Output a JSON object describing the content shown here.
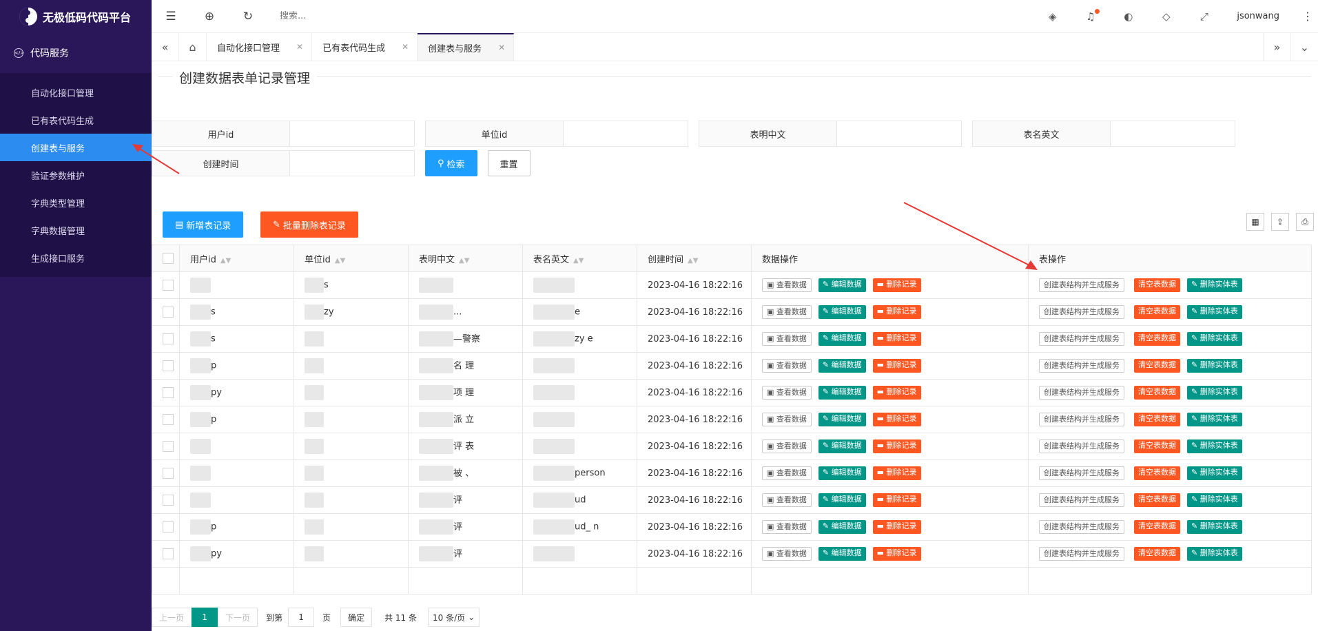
{
  "brand": {
    "title": "无极低码代码平台"
  },
  "sidebar": {
    "group_label": "代码服务",
    "items": [
      {
        "label": "自动化接口管理",
        "active": false
      },
      {
        "label": "已有表代码生成",
        "active": false
      },
      {
        "label": "创建表与服务",
        "active": true
      },
      {
        "label": "验证参数维护",
        "active": false
      },
      {
        "label": "字典类型管理",
        "active": false
      },
      {
        "label": "字典数据管理",
        "active": false
      },
      {
        "label": "生成接口服务",
        "active": false
      }
    ]
  },
  "header": {
    "search_placeholder": "搜索...",
    "username": "jsonwang",
    "notification_dot_color": "#ff5722",
    "icons": [
      "menu-fold-icon",
      "globe-icon",
      "refresh-icon",
      "layers-icon",
      "bell-icon",
      "palette-icon",
      "tag-icon",
      "fullscreen-icon",
      "more-vertical-icon"
    ]
  },
  "tabs": [
    {
      "label": "自动化接口管理",
      "active": false
    },
    {
      "label": "已有表代码生成",
      "active": false
    },
    {
      "label": "创建表与服务",
      "active": true
    }
  ],
  "page": {
    "title": "创建数据表单记录管理",
    "filters": {
      "user_id_label": "用户id",
      "unit_id_label": "单位id",
      "table_cn_label": "表明中文",
      "table_en_label": "表名英文",
      "created_label": "创建时间",
      "search_btn": "检索",
      "reset_btn": "重置"
    },
    "toolbar": {
      "add_btn": "新增表记录",
      "batch_delete_btn": "批量删除表记录",
      "add_color": "#1e9fff",
      "batch_delete_color": "#ff5722"
    }
  },
  "table": {
    "columns": [
      "用户id",
      "单位id",
      "表明中文",
      "表名英文",
      "创建时间",
      "数据操作",
      "表操作"
    ],
    "data_actions": [
      "查看数据",
      "编辑数据",
      "删除记录"
    ],
    "table_actions": [
      "创建表结构并生成服务",
      "清空表数据",
      "删除实体表"
    ],
    "rows": [
      {
        "user_id": "",
        "unit_id": "s",
        "table_cn": "",
        "table_en": "",
        "created": "2023-04-16 18:22:16"
      },
      {
        "user_id": "s",
        "unit_id": "zy",
        "table_cn": "...",
        "table_en": "e",
        "created": "2023-04-16 18:22:16"
      },
      {
        "user_id": "s",
        "unit_id": "",
        "table_cn": "—警察",
        "table_en": "zy e",
        "created": "2023-04-16 18:22:16"
      },
      {
        "user_id": "p",
        "unit_id": "",
        "table_cn": "名 理",
        "table_en": "",
        "created": "2023-04-16 18:22:16"
      },
      {
        "user_id": "py",
        "unit_id": "",
        "table_cn": "项 理",
        "table_en": "",
        "created": "2023-04-16 18:22:16"
      },
      {
        "user_id": "p",
        "unit_id": "",
        "table_cn": "派 立",
        "table_en": "",
        "created": "2023-04-16 18:22:16"
      },
      {
        "user_id": "",
        "unit_id": "",
        "table_cn": "评 表",
        "table_en": "",
        "created": "2023-04-16 18:22:16"
      },
      {
        "user_id": "",
        "unit_id": "",
        "table_cn": "被 、",
        "table_en": "person",
        "created": "2023-04-16 18:22:16"
      },
      {
        "user_id": "",
        "unit_id": "",
        "table_cn": "评",
        "table_en": "ud",
        "created": "2023-04-16 18:22:16"
      },
      {
        "user_id": "p",
        "unit_id": "",
        "table_cn": "评",
        "table_en": "ud_ n",
        "created": "2023-04-16 18:22:16"
      },
      {
        "user_id": "py",
        "unit_id": "",
        "table_cn": "评",
        "table_en": "",
        "created": "2023-04-16 18:22:16"
      }
    ]
  },
  "pagination": {
    "prev": "上一页",
    "current": "1",
    "next": "下一页",
    "goto_label": "到第",
    "goto_value": "1",
    "page_unit": "页",
    "confirm": "确定",
    "total": "共 11 条",
    "page_size": "10 条/页"
  }
}
